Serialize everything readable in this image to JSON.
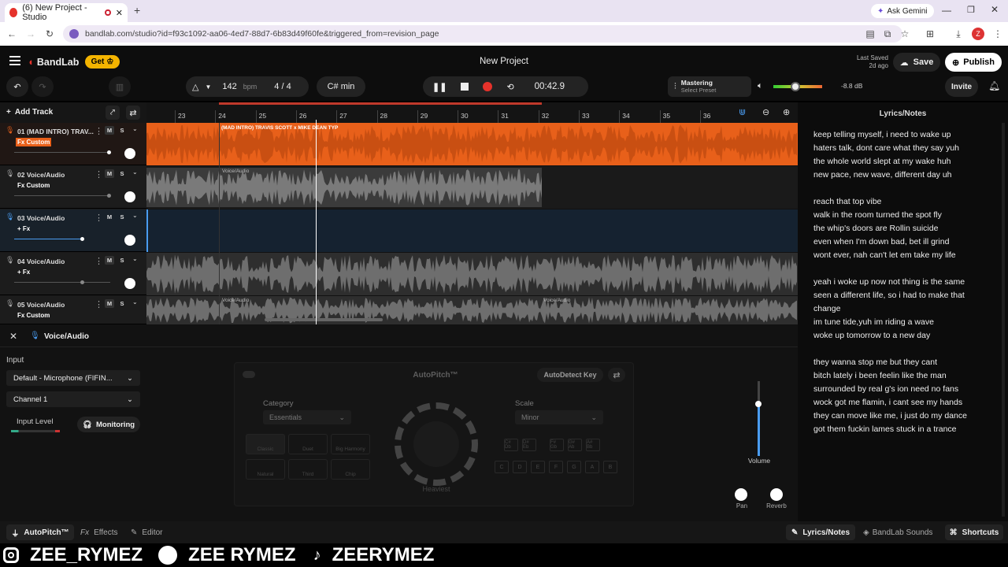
{
  "browser": {
    "tab_title": "(6) New Project - Studio",
    "url": "bandlab.com/studio?id=f93c1092-aa06-4ed7-88d7-6b83d49f60fe&triggered_from=revision_page",
    "ask_gemini": "Ask Gemini",
    "profile_badge": "Z"
  },
  "header": {
    "brand": "BandLab",
    "get_label": "Get",
    "project_title": "New Project",
    "last_saved_label": "Last Saved",
    "last_saved_value": "2d ago",
    "save_label": "Save",
    "publish_label": "Publish",
    "invite_label": "Invite"
  },
  "transport": {
    "bpm": "142",
    "bpm_unit": "bpm",
    "time_sig_num": "4",
    "time_sig_den": "4",
    "key": "C# min",
    "time": "00:42.9",
    "mastering_label": "Mastering",
    "mastering_preset": "Select Preset",
    "volume_db": "-8.8 dB"
  },
  "tracks_header": {
    "add_track": "Add Track"
  },
  "ruler": [
    "23",
    "24",
    "25",
    "26",
    "27",
    "28",
    "29",
    "30",
    "31",
    "32",
    "33",
    "34",
    "35",
    "36"
  ],
  "tracks": [
    {
      "name": "01  (MAD INTRO) TRAV...",
      "fx": "Fx Custom",
      "clip": "(MAD INTRO) TRAVIS SCOTT x MIKE DEAN TYP"
    },
    {
      "name": "02  Voice/Audio",
      "fx": "Fx Custom",
      "clip": "Voice/Audio"
    },
    {
      "name": "03  Voice/Audio",
      "fx": "+ Fx",
      "clip": ""
    },
    {
      "name": "04  Voice/Audio",
      "fx": "+ Fx",
      "clip": ""
    },
    {
      "name": "05  Voice/Audio",
      "fx": "Fx Custom",
      "clip": "Voice/Audio",
      "clip2": "Voice/Audio"
    }
  ],
  "panel": {
    "title": "Voice/Audio",
    "input_label": "Input",
    "input_device": "Default - Microphone (FIFIN...",
    "channel": "Channel 1",
    "input_level_label": "Input Level",
    "monitoring_label": "Monitoring"
  },
  "autopitch": {
    "title": "AutoPitch™",
    "autodetect": "AutoDetect Key",
    "category_label": "Category",
    "category_value": "Essentials",
    "scale_label": "Scale",
    "scale_value": "Minor",
    "knob_label": "Heaviest",
    "presets": [
      "Classic",
      "Duet",
      "Big Harmony",
      "Natural",
      "Third",
      "Chip"
    ],
    "keys_top": [
      "C# Db",
      "D# Eb",
      "F# Gb",
      "G# Ab",
      "A# Bb"
    ],
    "keys_bottom": [
      "C",
      "D",
      "E",
      "F",
      "G",
      "A",
      "B"
    ]
  },
  "mixer": {
    "volume_label": "Volume",
    "pan_label": "Pan",
    "reverb_label": "Reverb"
  },
  "lyrics": {
    "title": "Lyrics/Notes",
    "lines": [
      "keep telling myself, i need to wake up",
      "haters talk, dont care what they say yuh",
      "the whole world slept at my wake huh",
      "new pace, new wave, different day uh",
      "",
      "reach that top vibe",
      "walk in the room turned the spot fly",
      "the whip's doors are Rollin suicide",
      "even when I'm down bad, bet ill grind",
      "wont ever, nah can't let em take my life",
      "",
      "yeah i woke up now not thing is the same",
      "seen a different life, so i had to make that",
      "change",
      "im tune tide,yuh im riding a wave",
      "woke up tomorrow to a new day",
      "",
      "they wanna stop me but they cant",
      "bitch lately i been feelin like the man",
      "surrounded by real g's ion need no fans",
      "wock got me flamin, i cant see my hands",
      "they can move like me, i just do my dance",
      "got them fuckin lames stuck in a trance"
    ]
  },
  "footer": {
    "autopitch_tab": "AutoPitch™",
    "effects_tab": "Effects",
    "editor_tab": "Editor",
    "lyrics_tab": "Lyrics/Notes",
    "sounds_tab": "BandLab Sounds",
    "shortcuts_tab": "Shortcuts"
  },
  "overlay": {
    "instagram": "ZEE_RYMEZ",
    "spotify": "ZEE RYMEZ",
    "tiktok": "ZEERYMEZ"
  },
  "colors": {
    "accent": "#f25c19",
    "track_orange": "#e8601a",
    "record": "#e5322b",
    "playhead": "#ffffff"
  }
}
